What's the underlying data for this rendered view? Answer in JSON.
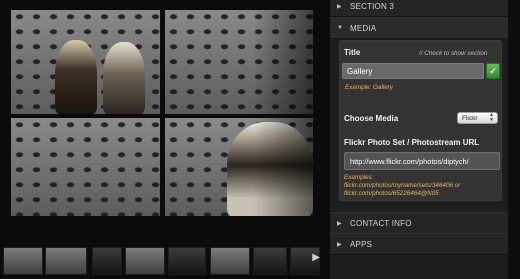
{
  "panel": {
    "sections": {
      "section3": "SECTION 3",
      "media": "MEDIA",
      "contact": "CONTACT INFO",
      "apps": "APPS"
    },
    "title_field": {
      "label": "Title",
      "hint": "// Check to show section",
      "value": "Gallery",
      "example_prefix": "Example:",
      "example_value": "Gallery",
      "checked": true
    },
    "choose_media": {
      "label": "Choose Media",
      "selected": "Flickr"
    },
    "flickr": {
      "label": "Flickr Photo Set / Photostream URL",
      "value": "http://www.flickr.com/photos/diptych/",
      "examples_label": "Examples:",
      "examples": [
        "flickr.com/photos/myname/sets/346406 or",
        "flickr.com/photos/65226464@N05"
      ]
    }
  },
  "icons": {
    "expand": "triangle-right-icon",
    "collapse": "triangle-down-icon",
    "check": "check-icon",
    "next": "arrow-right-icon"
  },
  "colors": {
    "accent_example": "#e7b65a",
    "toggle_green": "#3fa53a",
    "panel_bg": "#1e1e1e"
  }
}
